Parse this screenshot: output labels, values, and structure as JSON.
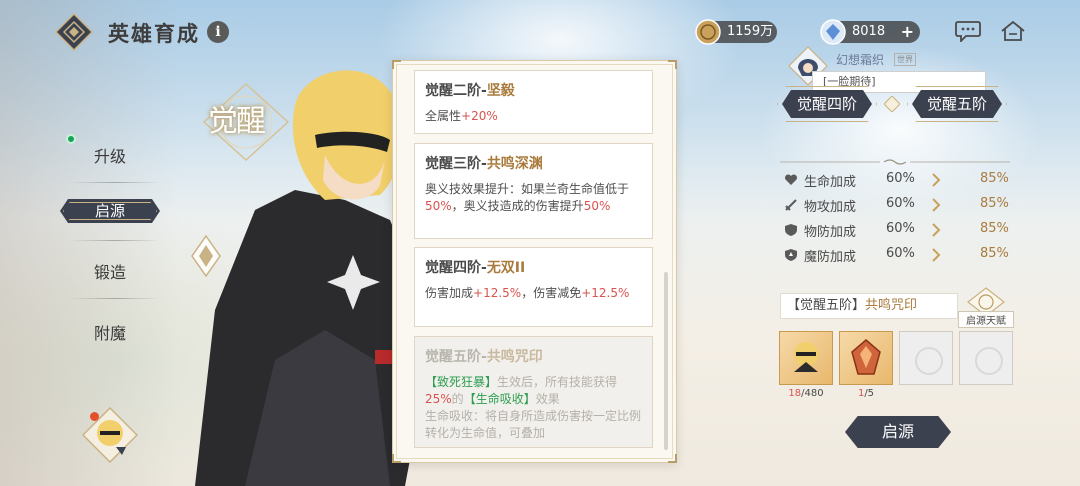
{
  "header": {
    "title": "英雄育成",
    "info_icon": "i"
  },
  "nav": {
    "items": [
      {
        "label": "升级"
      },
      {
        "label": "启源"
      },
      {
        "label": "锻造"
      },
      {
        "label": "附魔"
      }
    ],
    "active_index": 1
  },
  "emblem": {
    "text": "觉醒"
  },
  "currency": {
    "gold": "1159万",
    "gems": "8018",
    "gems_add": "+"
  },
  "chat": {
    "name": "幻想霜织",
    "tag": "世界",
    "message": "[一脸期待]"
  },
  "awakening_list": [
    {
      "stage": "觉醒二阶-",
      "name": "坚毅",
      "lines": [
        {
          "t": "全属性",
          "c": ""
        },
        {
          "t": "+20%",
          "c": "red"
        }
      ]
    },
    {
      "stage": "觉醒三阶-",
      "name": "共鸣深渊",
      "lines": [
        {
          "t": "奥义技效果提升：如果兰奇生命值低于",
          "c": ""
        },
        {
          "t": "50%",
          "c": "red"
        },
        {
          "t": "，奥义技造成的伤害提升",
          "c": ""
        },
        {
          "t": "50%",
          "c": "red"
        }
      ]
    },
    {
      "stage": "觉醒四阶-",
      "name": "无双II",
      "lines": [
        {
          "t": "伤害加成",
          "c": ""
        },
        {
          "t": "+12.5%",
          "c": "red"
        },
        {
          "t": "，伤害减免",
          "c": ""
        },
        {
          "t": "+12.5%",
          "c": "red"
        }
      ]
    },
    {
      "stage": "觉醒五阶-",
      "name": "共鸣咒印",
      "lines": [
        {
          "t": "【致死狂暴】",
          "c": "green"
        },
        {
          "t": "生效后，所有技能获得",
          "c": ""
        },
        {
          "t": "25%",
          "c": "red"
        },
        {
          "t": "的",
          "c": ""
        },
        {
          "t": "【生命吸收】",
          "c": "green"
        },
        {
          "t": "效果",
          "c": ""
        },
        {
          "t": "生命吸收：将自身所造成伤害按一定比例转化为生命值，可叠加",
          "c": "br"
        }
      ]
    }
  ],
  "stage_tabs": {
    "current": "觉醒四阶",
    "next": "觉醒五阶"
  },
  "stats": [
    {
      "name": "生命加成",
      "current": "60%",
      "next": "85%",
      "icon": "heart-icon"
    },
    {
      "name": "物攻加成",
      "current": "60%",
      "next": "85%",
      "icon": "sword-icon"
    },
    {
      "name": "物防加成",
      "current": "60%",
      "next": "85%",
      "icon": "shield-icon"
    },
    {
      "name": "魔防加成",
      "current": "60%",
      "next": "85%",
      "icon": "magic-shield-icon"
    }
  ],
  "rune": {
    "label_prefix": "【觉醒五阶】",
    "label_name": "共鸣咒印",
    "talent_label": "启源天赋"
  },
  "slots": [
    {
      "filled": true,
      "have": "18",
      "need": "/480"
    },
    {
      "filled": true,
      "have": "1",
      "need": "/5"
    },
    {
      "filled": false
    },
    {
      "filled": false
    }
  ],
  "actions": {
    "awaken": "启源"
  },
  "colors": {
    "accent": "#a97b3d",
    "dark_button": "#3c4150",
    "highlight_red": "#d9534f",
    "highlight_green": "#2e9e52"
  }
}
